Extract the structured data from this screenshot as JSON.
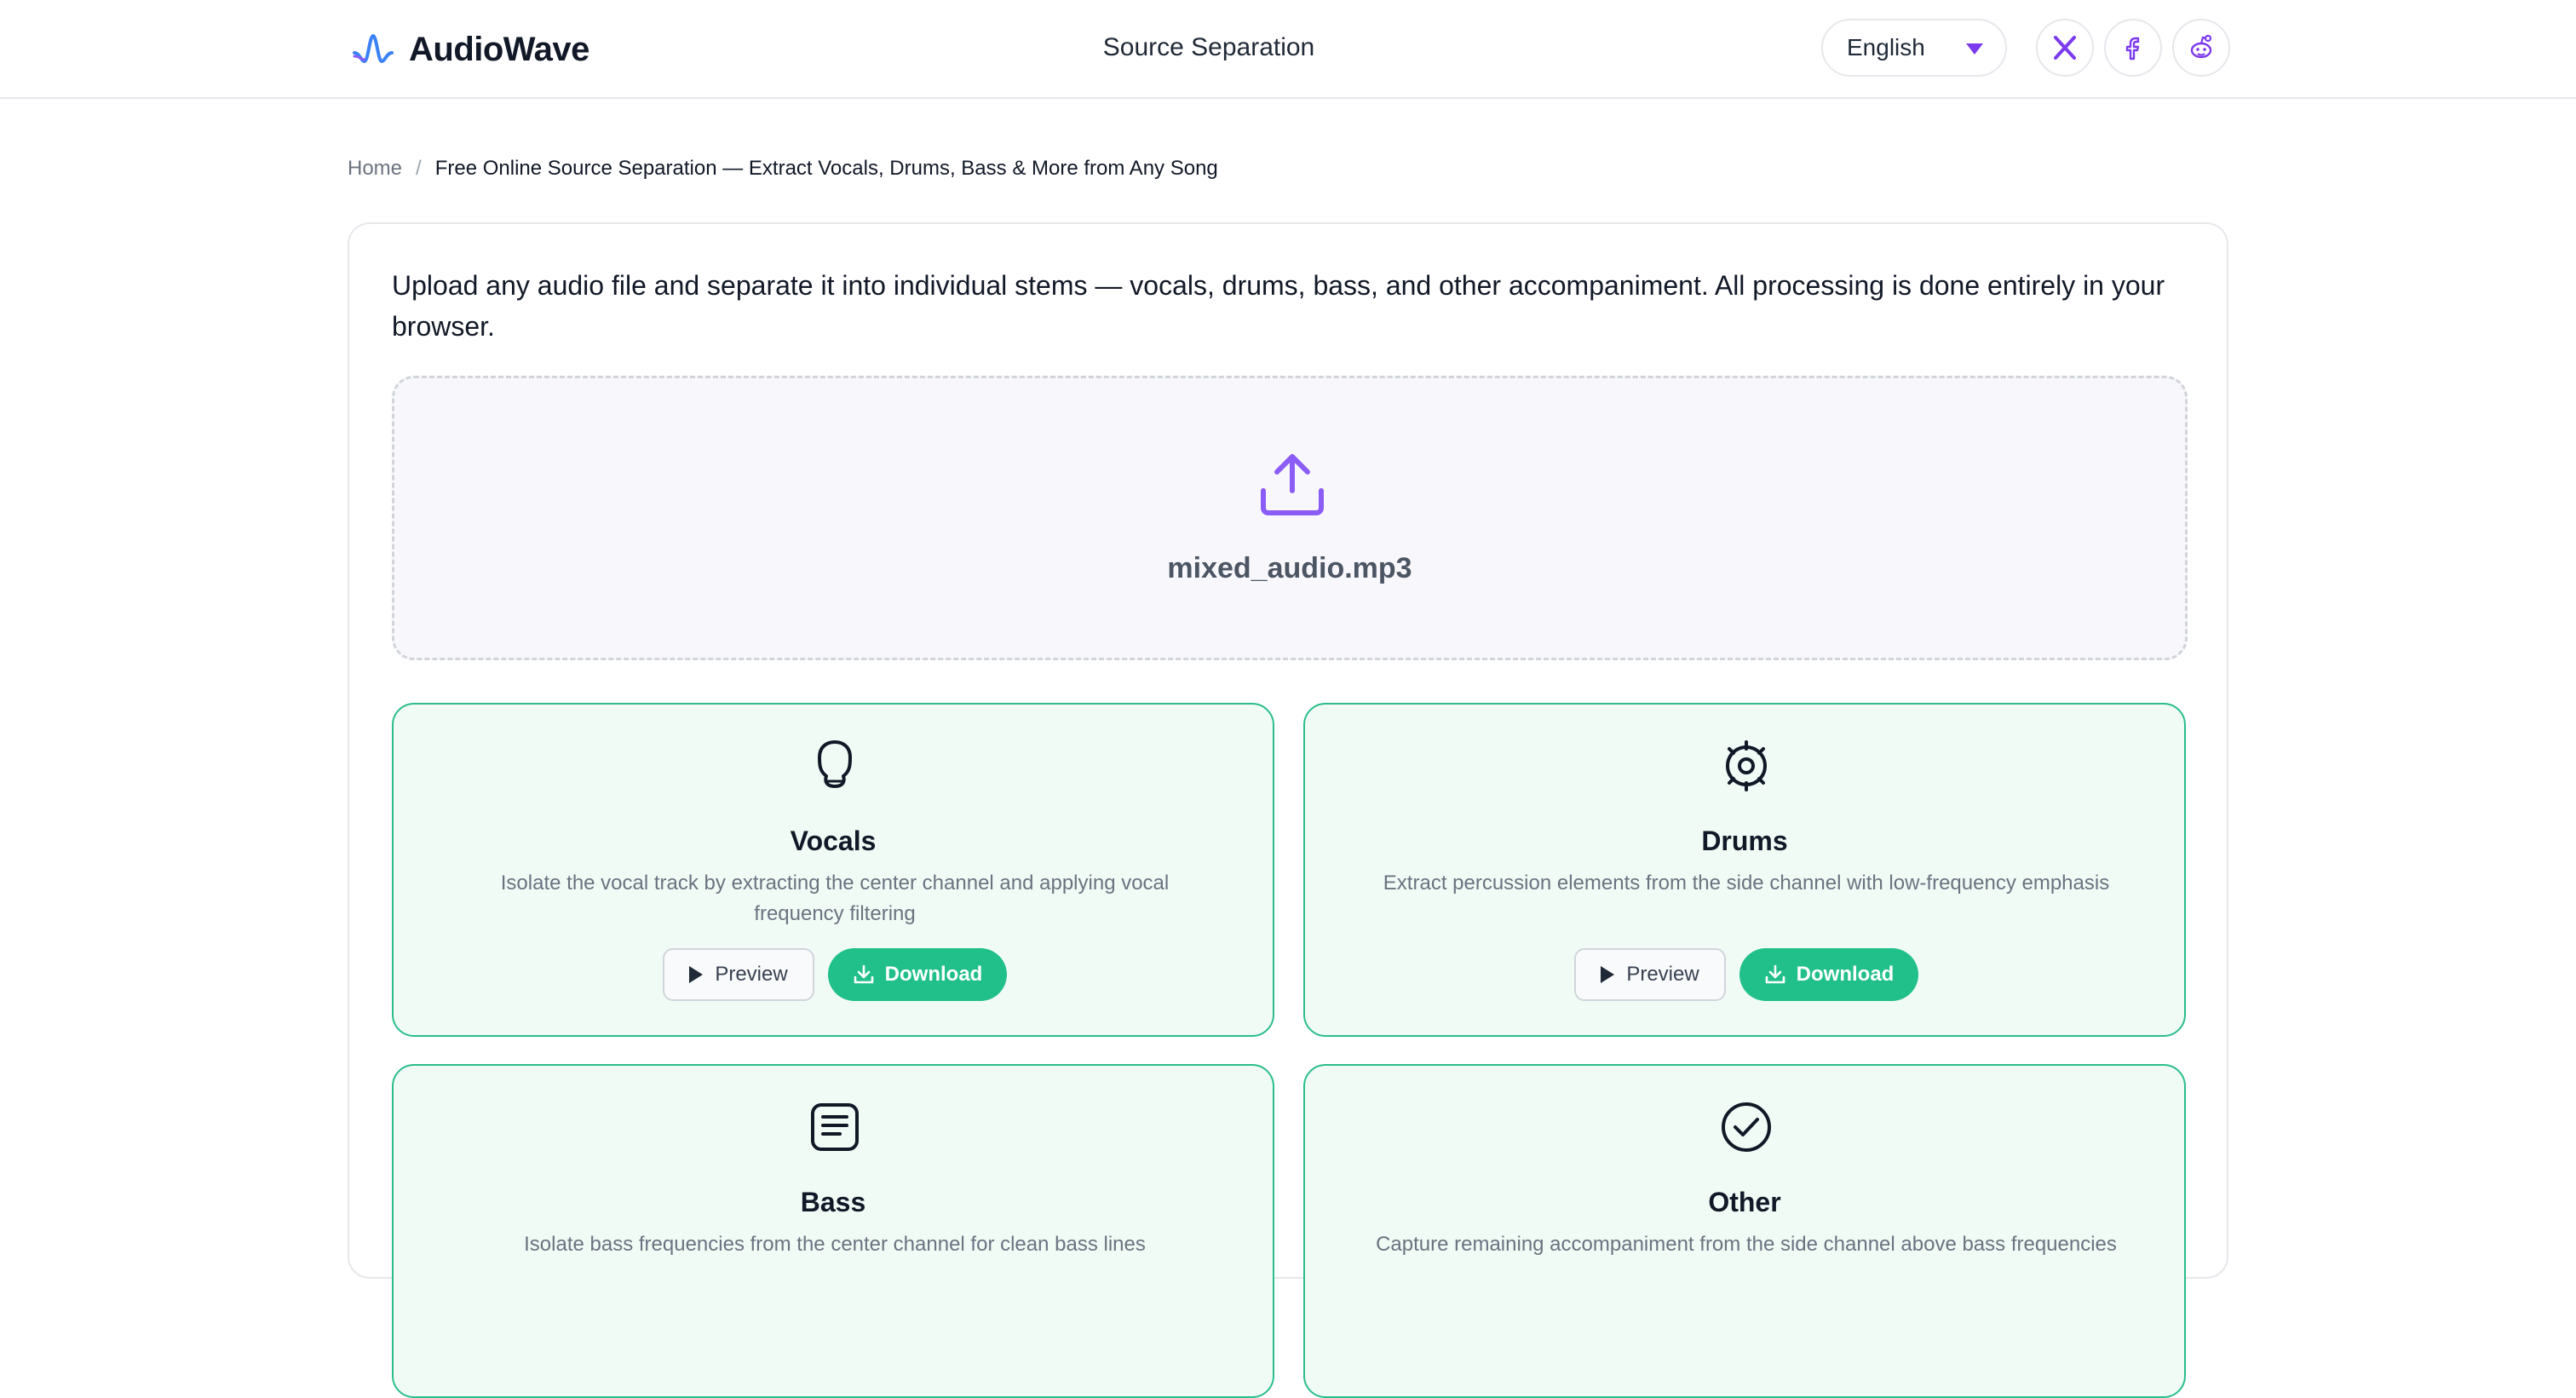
{
  "header": {
    "app_name": "AudioWave",
    "nav_title": "Source Separation",
    "language": {
      "selected": "English"
    },
    "social": [
      "x-icon",
      "facebook-icon",
      "reddit-icon"
    ]
  },
  "breadcrumb": {
    "home": "Home",
    "separator": "/",
    "current": "Free Online Source Separation — Extract Vocals, Drums, Bass & More from Any Song"
  },
  "intro": "Upload any audio file and separate it into individual stems — vocals, drums, bass, and other accompaniment. All processing is done entirely in your browser.",
  "upload": {
    "file_name": "mixed_audio.mp3",
    "icon": "upload-icon"
  },
  "stems": [
    {
      "icon": "vocals-icon",
      "title": "Vocals",
      "description": "Isolate the vocal track by extracting the center channel and applying vocal frequency filtering",
      "preview_label": "Preview",
      "download_label": "Download"
    },
    {
      "icon": "drums-icon",
      "title": "Drums",
      "description": "Extract percussion elements from the side channel with low-frequency emphasis",
      "preview_label": "Preview",
      "download_label": "Download"
    },
    {
      "icon": "bass-icon",
      "title": "Bass",
      "description": "Isolate bass frequencies from the center channel for clean bass lines"
    },
    {
      "icon": "other-icon",
      "title": "Other",
      "description": "Capture remaining accompaniment from the side channel above bass frequencies"
    }
  ],
  "colors": {
    "accent": "#7c3aed",
    "success": "#21c08b",
    "stem_border": "#2bbd8c",
    "stem_bg": "#f0fbf6"
  }
}
